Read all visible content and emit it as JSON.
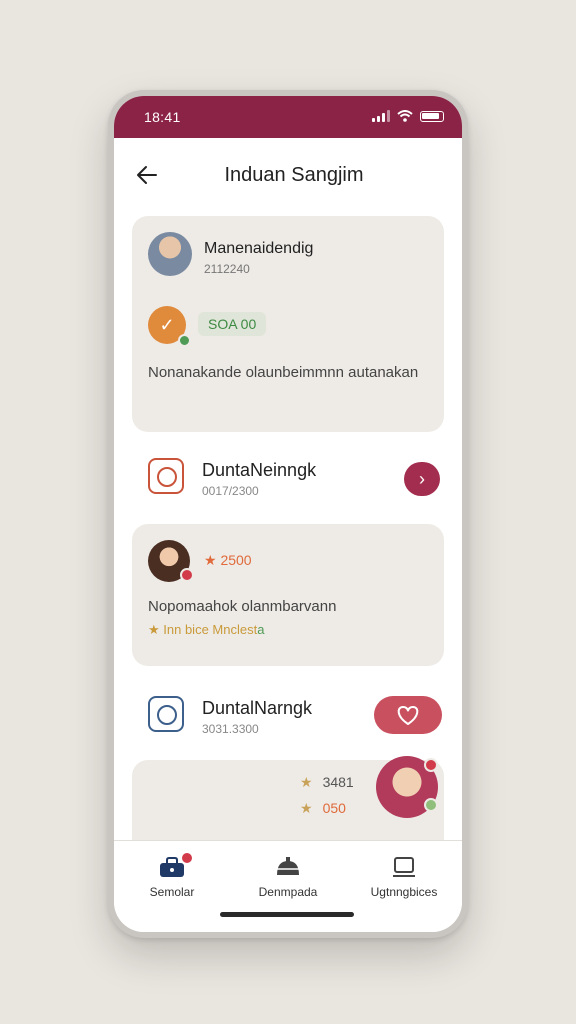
{
  "status": {
    "time": "18:41"
  },
  "header": {
    "title": "Induan Sangjim"
  },
  "card1": {
    "name": "Manenaidendig",
    "id": "2112240",
    "score": "SOA 00",
    "description": "Nonanakande olaunbeimmnn autanakan"
  },
  "row1": {
    "title": "DuntaNeinngk",
    "subtitle": "0017/2300"
  },
  "card2": {
    "rating": "★ 2500",
    "description": "Nopomaahok olanmbarvann",
    "tagline_a": "★ Inn bice Mnclest",
    "tagline_b": "a"
  },
  "row2": {
    "title": "DuntalNarngk",
    "subtitle": "3031.3300"
  },
  "card3": {
    "stat1": "3481",
    "stat2": "050"
  },
  "tabbar": {
    "tab1": "Semolar",
    "tab2": "Denmpada",
    "tab3": "Ugtnngbices"
  },
  "colors": {
    "accent": "#8a2346",
    "card": "#eeebe7",
    "heart": "#c9505f",
    "green": "#4f9b55",
    "orange": "#e08a3c"
  }
}
